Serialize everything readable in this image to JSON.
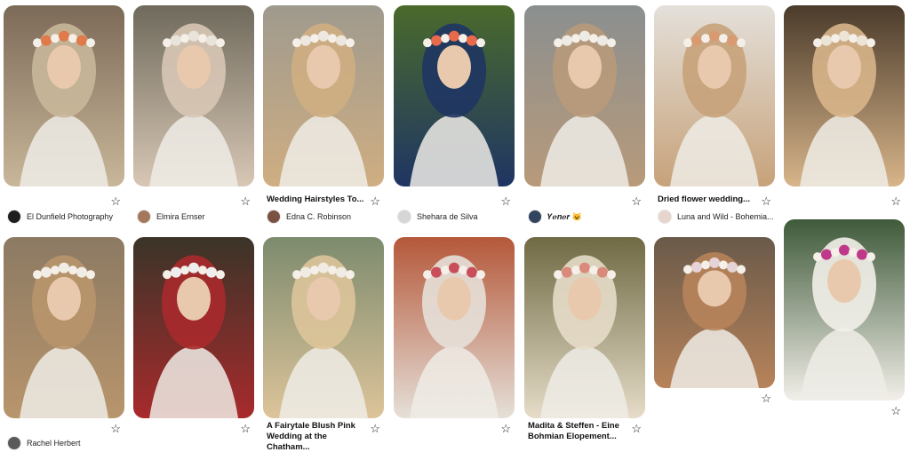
{
  "colors": {
    "background": "#ffffff",
    "text": "#111111"
  },
  "pins": [
    {
      "id": "p1",
      "title": "",
      "author": "El Dunfield Photography",
      "image_colors": [
        "#7c6a58",
        "#c9b79a",
        "#e07a4a"
      ],
      "avatar_color": "#1e1e1e"
    },
    {
      "id": "p2",
      "title": "",
      "author": "Elmira Ernser",
      "image_colors": [
        "#6f6a5c",
        "#d8c7b5",
        "#e8e4da"
      ],
      "avatar_color": "#a3785c"
    },
    {
      "id": "p3",
      "title": "Wedding Hairstyles To...",
      "author": "Edna C. Robinson",
      "image_colors": [
        "#9f9a8e",
        "#cfae82",
        "#ece8df"
      ],
      "avatar_color": "#7a5143"
    },
    {
      "id": "p4",
      "title": "",
      "author": "Shehara de Silva",
      "image_colors": [
        "#4a6a2c",
        "#1f3563",
        "#e86a4a"
      ],
      "avatar_color": "#d6d6d6"
    },
    {
      "id": "p5",
      "title": "",
      "author": "𝒀𝒆𝒏𝒆𝒓 😺",
      "image_colors": [
        "#8b8f90",
        "#b89a7a",
        "#ecebe6"
      ],
      "avatar_color": "#31465e"
    },
    {
      "id": "p6",
      "title": "Dried flower wedding...",
      "author": "Luna and Wild - Bohemia...",
      "image_colors": [
        "#e4e0da",
        "#c7a27a",
        "#d99a72"
      ],
      "avatar_color": "#e7d4cd"
    },
    {
      "id": "p7",
      "title": "",
      "author": "",
      "image_colors": [
        "#4b3b2b",
        "#d8b58a",
        "#ede4d8"
      ],
      "avatar_color": ""
    },
    {
      "id": "p8",
      "title": "",
      "author": "Rachel Herbert",
      "image_colors": [
        "#8c7a63",
        "#b8956c",
        "#f0ece6"
      ],
      "avatar_color": "#5a5a5a"
    },
    {
      "id": "p9",
      "title": "",
      "author": "",
      "image_colors": [
        "#3a3428",
        "#a82a2c",
        "#eeeeee"
      ],
      "avatar_color": ""
    },
    {
      "id": "p10",
      "title": "A Fairytale Blush Pink Wedding at the Chatham...",
      "author": "",
      "image_colors": [
        "#7d8b6e",
        "#ddc49a",
        "#f0ece4"
      ],
      "avatar_color": ""
    },
    {
      "id": "p11",
      "title": "",
      "author": "",
      "image_colors": [
        "#b5583a",
        "#e5e0d8",
        "#c94e5a"
      ],
      "avatar_color": ""
    },
    {
      "id": "p12",
      "title": "Madita & Steffen - Eine Bohmian Elopement...",
      "author": "",
      "image_colors": [
        "#6f6a44",
        "#e6dcc8",
        "#d98a7a"
      ],
      "avatar_color": ""
    },
    {
      "id": "p13",
      "title": "",
      "author": "",
      "image_colors": [
        "#6a5a4a",
        "#b7835a",
        "#e5d3d8"
      ],
      "avatar_color": ""
    },
    {
      "id": "p14",
      "title": "",
      "author": "",
      "image_colors": [
        "#3f5a3a",
        "#f2efe9",
        "#c0388a"
      ],
      "avatar_color": ""
    }
  ]
}
